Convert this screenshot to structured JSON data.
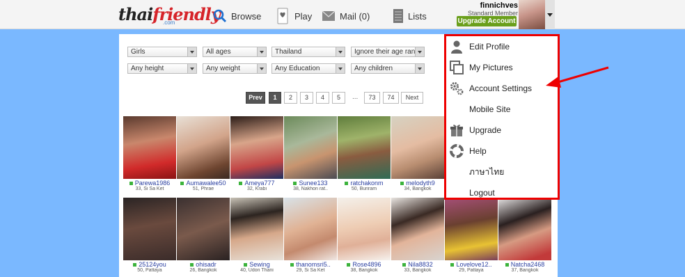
{
  "header": {
    "logo": {
      "part1": "thai",
      "part2": "friendly",
      "sub": ".com"
    },
    "nav": [
      {
        "label": "Browse",
        "icon": "search-icon"
      },
      {
        "label": "Play",
        "icon": "heart-card-icon"
      },
      {
        "label": "Mail (0)",
        "icon": "mail-icon"
      },
      {
        "label": "Lists",
        "icon": "list-icon"
      }
    ],
    "user": {
      "name": "finnichves",
      "level": "Standard Member",
      "upgrade_label": "Upgrade Account"
    }
  },
  "filters": [
    {
      "value": "Girls"
    },
    {
      "value": "All ages"
    },
    {
      "value": "Thailand"
    },
    {
      "value": "Ignore their age range"
    },
    {
      "value": "Any height"
    },
    {
      "value": "Any weight"
    },
    {
      "value": "Any Education"
    },
    {
      "value": "Any children"
    }
  ],
  "pagination": {
    "prev": "Prev",
    "pages": [
      "1",
      "2",
      "3",
      "4",
      "5"
    ],
    "dots": "...",
    "last_pages": [
      "73",
      "74"
    ],
    "next": "Next",
    "current": "1"
  },
  "profiles": [
    {
      "name": "Parewa1986",
      "meta": "33, Si Sa Ket"
    },
    {
      "name": "Aumawalee50",
      "meta": "51, Phrae"
    },
    {
      "name": "Ameya777",
      "meta": "32, Krabi"
    },
    {
      "name": "Sunee133",
      "meta": "38, Nakhon rat.."
    },
    {
      "name": "ratchakonm",
      "meta": "50, Buriram"
    },
    {
      "name": "melodyth9",
      "meta": "34, Bangkok"
    },
    {
      "name": "25124you",
      "meta": "50, Pattaya"
    },
    {
      "name": "ohisadr",
      "meta": "26, Bangkok"
    },
    {
      "name": "Sewing",
      "meta": "40, Udon Thani"
    },
    {
      "name": "thanomsri5..",
      "meta": "29, Si Sa Ket"
    },
    {
      "name": "Rose4896",
      "meta": "38, Bangkok"
    },
    {
      "name": "Nila8832",
      "meta": "33, Bangkok"
    },
    {
      "name": "Lovelove12..",
      "meta": "29, Pattaya"
    },
    {
      "name": "Natcha2468",
      "meta": "37, Bangkok"
    }
  ],
  "dropdown": {
    "items": [
      {
        "label": "Edit Profile",
        "icon": "person-icon"
      },
      {
        "label": "My Pictures",
        "icon": "pictures-icon"
      },
      {
        "label": "Account Settings",
        "icon": "gears-icon"
      },
      {
        "label": "Mobile Site",
        "icon": ""
      },
      {
        "label": "Upgrade",
        "icon": "gift-icon"
      },
      {
        "label": "Help",
        "icon": "lifebuoy-icon"
      },
      {
        "label": "ภาษาไทย",
        "icon": ""
      },
      {
        "label": "Logout",
        "icon": ""
      }
    ]
  },
  "colors": {
    "background": "#7ab8ff",
    "highlight_border": "#ee0000",
    "upgrade_button": "#6a9f1b",
    "online_dot": "#3cb33c",
    "profile_name": "#2a3fa0"
  }
}
